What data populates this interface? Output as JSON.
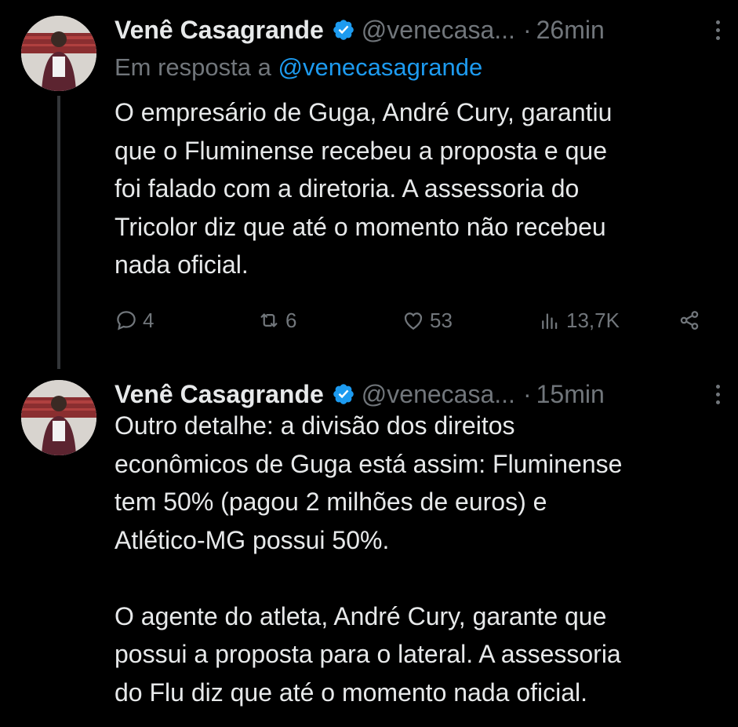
{
  "colors": {
    "background": "#000000",
    "text": "#e7e9ea",
    "muted": "#71767b",
    "accent": "#1d9bf0",
    "thread_line": "#333639"
  },
  "tweets": [
    {
      "author_name": "Venê Casagrande",
      "author_handle": "@venecasa...",
      "dot": "·",
      "time": "26min",
      "verified_icon": "verified-badge-icon",
      "reply_prefix": "Em resposta a ",
      "reply_mention": "@venecasagrande",
      "text": "O empresário de Guga, André Cury, garantiu\nque o Fluminense recebeu a proposta e que\nfoi falado com a diretoria. A assessoria do\nTricolor diz que até o momento não recebeu\nnada oficial.",
      "actions": {
        "replies": "4",
        "retweets": "6",
        "likes": "53",
        "views": "13,7K"
      }
    },
    {
      "author_name": "Venê Casagrande",
      "author_handle": "@venecasa...",
      "dot": "·",
      "time": "15min",
      "verified_icon": "verified-badge-icon",
      "text": "Outro detalhe: a divisão dos direitos\neconômicos de Guga está assim: Fluminense\ntem 50% (pagou 2 milhões de euros) e\nAtlético-MG possui 50%.\n\nO agente do atleta, André Cury, garante que\npossui a proposta para o lateral. A assessoria\ndo Flu diz que até o momento nada oficial."
    }
  ]
}
